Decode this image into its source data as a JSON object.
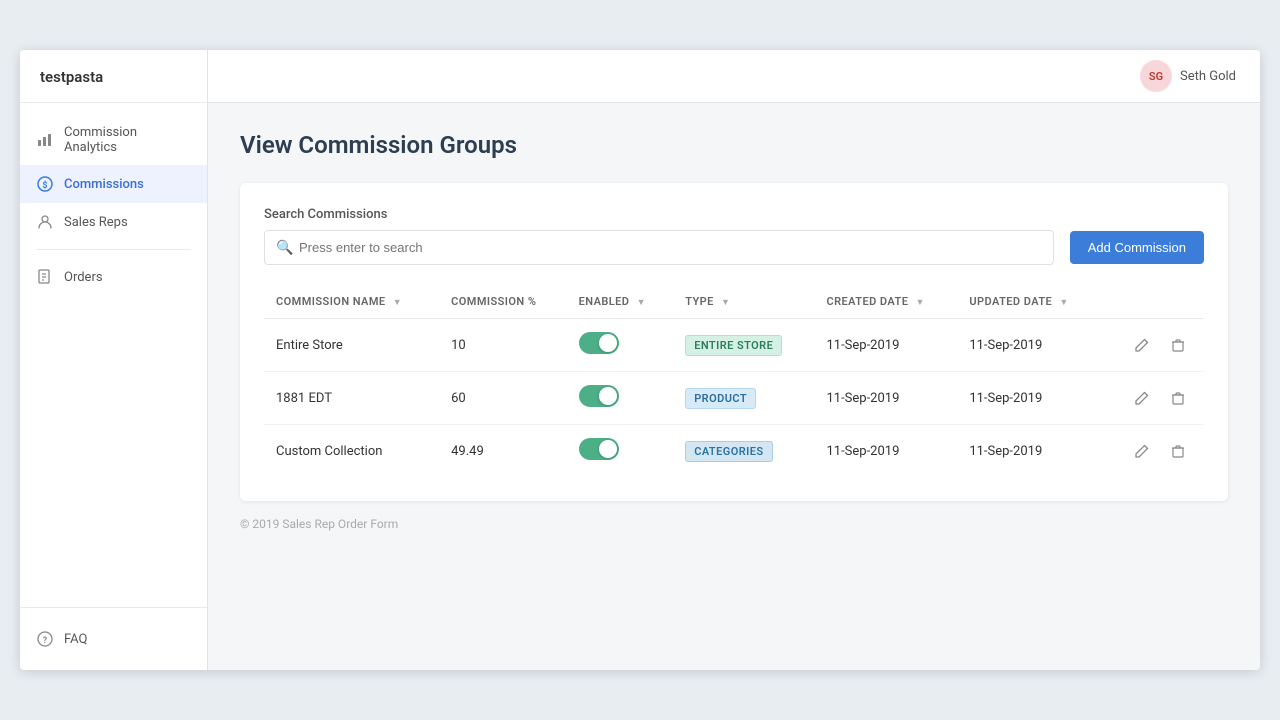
{
  "app": {
    "store_name": "testpasta",
    "page_title": "View Commission Groups"
  },
  "user": {
    "initials": "SG",
    "name": "Seth Gold"
  },
  "sidebar": {
    "items": [
      {
        "id": "commission-analytics",
        "label": "Commission Analytics",
        "icon": "chart-icon",
        "active": false
      },
      {
        "id": "commissions",
        "label": "Commissions",
        "icon": "dollar-icon",
        "active": true
      },
      {
        "id": "sales-reps",
        "label": "Sales Reps",
        "icon": "person-icon",
        "active": false
      },
      {
        "id": "orders",
        "label": "Orders",
        "icon": "orders-icon",
        "active": false
      }
    ],
    "faq": {
      "label": "FAQ",
      "icon": "help-icon"
    }
  },
  "search": {
    "label": "Search Commissions",
    "placeholder": "Press enter to search"
  },
  "add_button_label": "Add Commission",
  "table": {
    "columns": [
      {
        "key": "commission_name",
        "label": "COMMISSION NAME"
      },
      {
        "key": "commission_pct",
        "label": "COMMISSION %"
      },
      {
        "key": "enabled",
        "label": "ENABLED"
      },
      {
        "key": "type",
        "label": "TYPE"
      },
      {
        "key": "created_date",
        "label": "CREATED DATE"
      },
      {
        "key": "updated_date",
        "label": "UPDATED DATE"
      }
    ],
    "rows": [
      {
        "commission_name": "Entire Store",
        "commission_pct": "10",
        "enabled": true,
        "type": "ENTIRE STORE",
        "type_key": "entire-store",
        "created_date": "11-Sep-2019",
        "updated_date": "11-Sep-2019"
      },
      {
        "commission_name": "1881 EDT",
        "commission_pct": "60",
        "enabled": true,
        "type": "PRODUCT",
        "type_key": "product",
        "created_date": "11-Sep-2019",
        "updated_date": "11-Sep-2019"
      },
      {
        "commission_name": "Custom Collection",
        "commission_pct": "49.49",
        "enabled": true,
        "type": "CATEGORIES",
        "type_key": "categories",
        "created_date": "11-Sep-2019",
        "updated_date": "11-Sep-2019"
      }
    ]
  },
  "footer": {
    "text": "© 2019 Sales Rep Order Form"
  }
}
